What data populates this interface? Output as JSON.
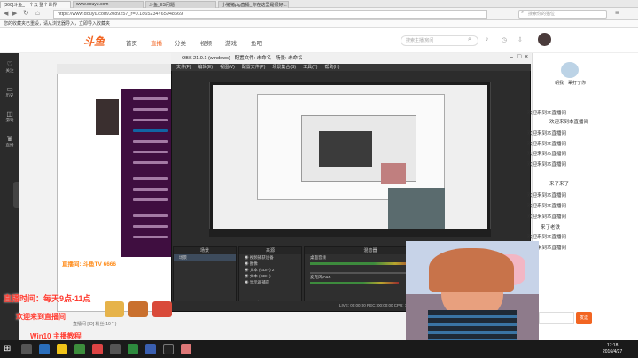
{
  "browser": {
    "tabs": [
      "[360]斗鱼_一个云 整个世界",
      "www.douyu.com",
      "斗鱼_IIS问题",
      "小猪猪pig直播_你在这里是很好..."
    ],
    "url": "https://www.douyu.com/2089257_r=0.1865234765948669",
    "search_placeholder": "搜索你的猫位",
    "bookmark_notice": "您的收藏夹已重设，请从浏览器导入，立即导入收藏夹"
  },
  "site": {
    "logo": "斗鱼",
    "nav": [
      "首页",
      "直播",
      "分类",
      "视频",
      "游戏",
      "鱼吧"
    ],
    "search_placeholder": "搜索主播/房间",
    "login_label": "立即登录"
  },
  "sidebar": [
    "关注",
    "历史",
    "游戏",
    "直播",
    "更多"
  ],
  "obs": {
    "title": "OBS 21.0.1 (windows) - 配置文件: 未命名 - 场景: 未命名",
    "menu": [
      "文件(F)",
      "编辑(E)",
      "视图(V)",
      "配置文件(P)",
      "场景集合(S)",
      "工具(T)",
      "帮助(H)"
    ],
    "panels": {
      "scenes_title": "场景",
      "scenes": [
        "场景"
      ],
      "sources_title": "来源",
      "sources": [
        "视频捕获设备",
        "图像",
        "文本 (GDI+) 2",
        "文本 (GDI+)",
        "显示器捕获"
      ],
      "mixer_title": "混音器",
      "mixer": [
        "桌面音频",
        "麦克风/Aux"
      ]
    },
    "status": "LIVE: 00:00:00   REC: 00:00:00   CPU: 7.6%, 30.00 fps"
  },
  "chat": {
    "user": "朝我一辈打了你",
    "messages": [
      "欢迎来到本直播间",
      "欢迎来到本直播间",
      "欢迎来到本直播间",
      "欢迎来到本直播间",
      "欢迎来到本直播间",
      "欢迎来到本直播间",
      "来了来了",
      "欢迎来到本直播间",
      "欢迎来到本直播间",
      "欢迎来到本直播间",
      "来了老铁",
      "欢迎来到本直播间",
      "欢迎来到本直播间"
    ],
    "send_label": "发送"
  },
  "overlay": {
    "line1": "直播时间：每天9点-11点",
    "line2": "欢迎来到直播间",
    "danmu": "直播间: 斗鱼TV 6666",
    "bottom": "Win10 主播教程",
    "caption": "直播间 [ID] 粉丝(10个)"
  },
  "taskbar": {
    "time": "17:18",
    "date": "2016/4/27"
  }
}
